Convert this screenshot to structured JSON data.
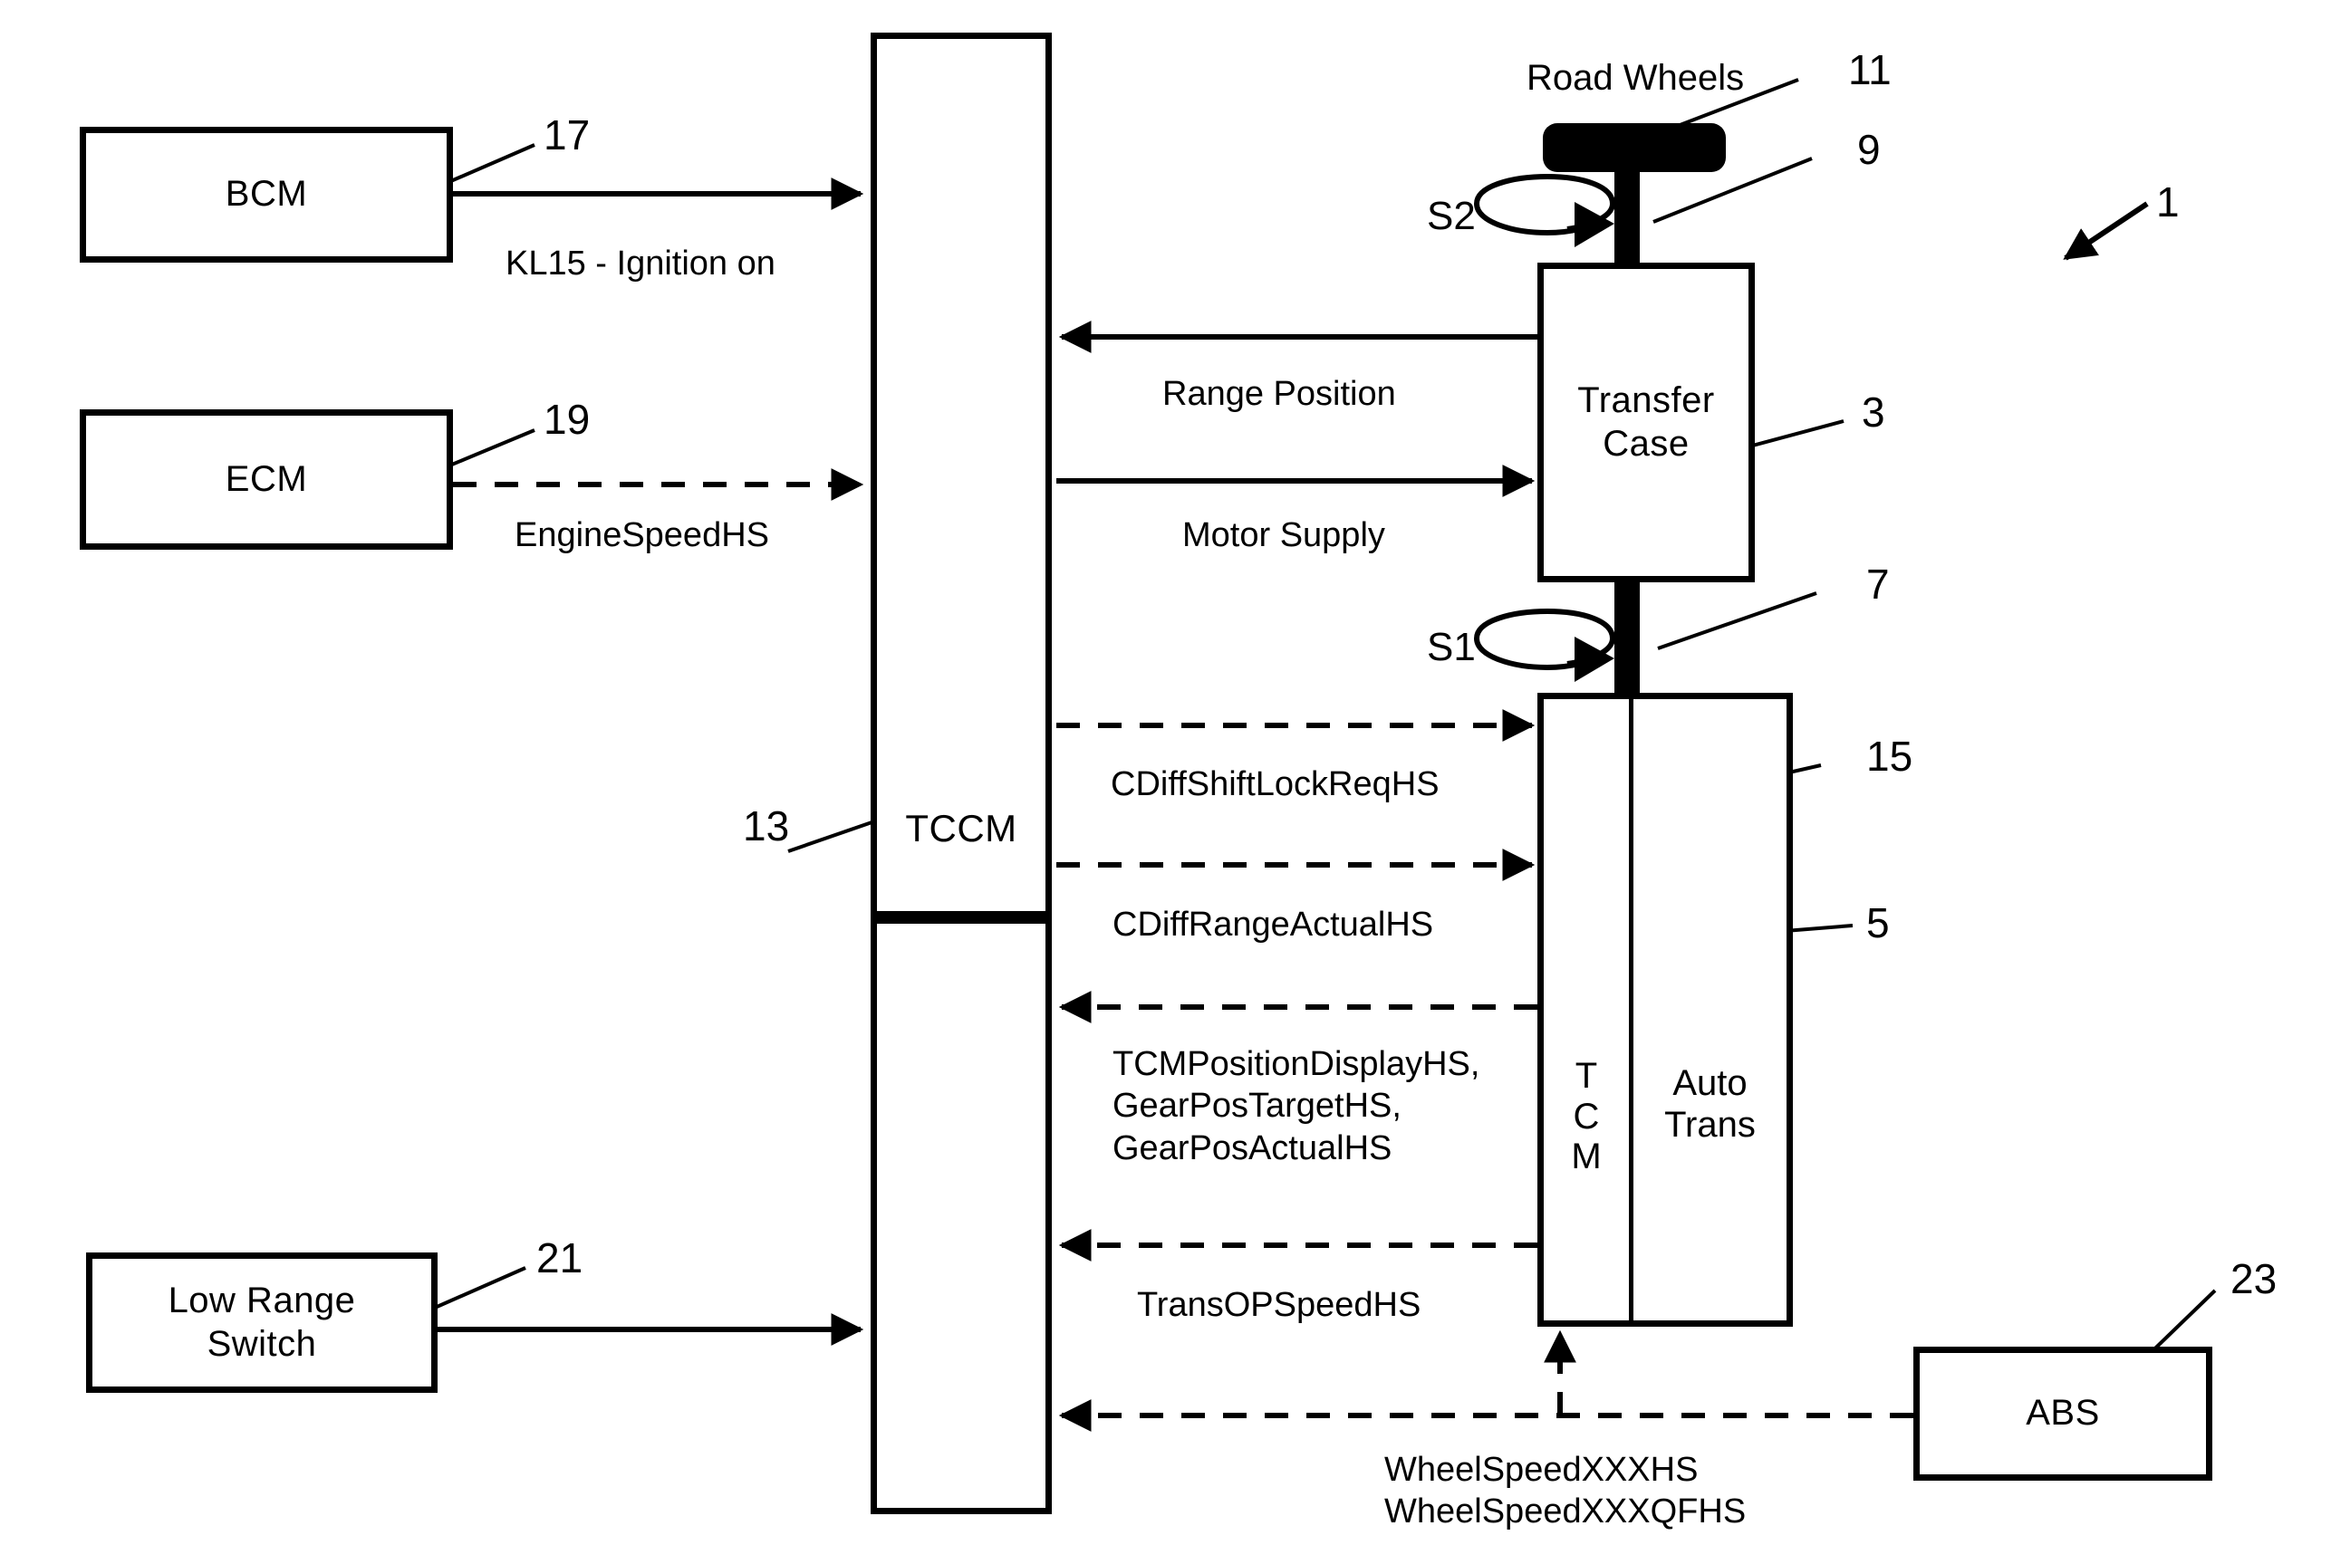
{
  "figure": {
    "figure_ref": "1"
  },
  "blocks": {
    "bcm": {
      "label": "BCM",
      "ref": "17"
    },
    "ecm": {
      "label": "ECM",
      "ref": "19"
    },
    "low_range": {
      "label": "Low Range\nSwitch",
      "ref": "21"
    },
    "tccm": {
      "label": "TCCM",
      "ref": "13"
    },
    "transfer": {
      "label": "Transfer\nCase",
      "ref": "3"
    },
    "tcm": {
      "label": "T\nC\nM",
      "ref": "15"
    },
    "auto_trans": {
      "label": "Auto\nTrans",
      "ref": "5"
    },
    "abs": {
      "label": "ABS",
      "ref": "23"
    }
  },
  "mechanical": {
    "road_wheels_label": "Road Wheels",
    "road_wheels_ref": "11",
    "upper_shaft_ref": "9",
    "lower_shaft_ref": "7",
    "rotation_upper": "S2",
    "rotation_lower": "S1"
  },
  "signals": {
    "kl15": "KL15 - Ignition on",
    "engine_speed": "EngineSpeedHS",
    "range_position": "Range Position",
    "motor_supply": "Motor Supply",
    "cdiff_shift": "CDiffShiftLockReqHS",
    "cdiff_range": "CDiffRangeActualHS",
    "tcm_position": "TCMPositionDisplayHS,\nGearPosTargetHS,\nGearPosActualHS",
    "trans_op_speed": "TransOPSpeedHS",
    "wheel_speed": "WheelSpeedXXXHS\nWheelSpeedXXXQFHS"
  },
  "colors": {
    "ink": "#000000",
    "paper": "#ffffff"
  }
}
